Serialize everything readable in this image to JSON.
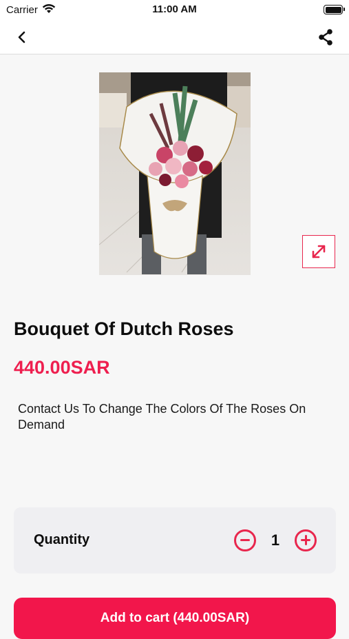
{
  "status_bar": {
    "carrier": "Carrier",
    "time": "11:00 AM"
  },
  "nav": {
    "back_icon": "chevron-left-icon",
    "share_icon": "share-icon"
  },
  "product": {
    "image_alt": "bouquet-photo",
    "title": "Bouquet Of Dutch Roses",
    "price": "440.00SAR",
    "description": "Contact Us To Change The Colors Of The Roses On Demand"
  },
  "quantity": {
    "label": "Quantity",
    "value": "1"
  },
  "cart": {
    "button_label": "Add to cart (440.00SAR)"
  },
  "colors": {
    "accent": "#ee1f4f",
    "background": "#f7f7f7",
    "card": "#efeff2"
  }
}
